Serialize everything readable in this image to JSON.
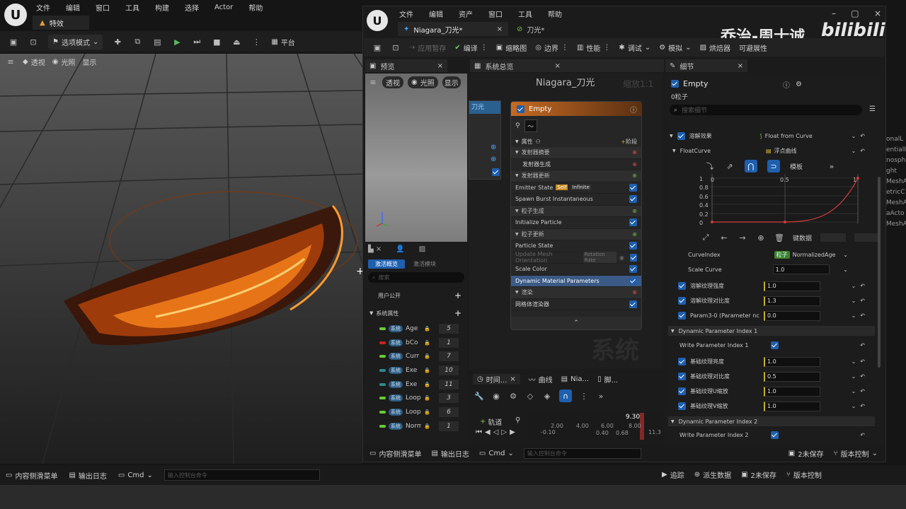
{
  "main": {
    "title": "特效",
    "menu": [
      "文件",
      "编辑",
      "窗口",
      "工具",
      "构建",
      "选择",
      "Actor",
      "帮助"
    ],
    "mode": "选项模式",
    "platform": "平台",
    "viewport_buttons": [
      "透视",
      "光照",
      "显示"
    ]
  },
  "niagara": {
    "menu": [
      "文件",
      "编辑",
      "资产",
      "窗口",
      "工具",
      "帮助"
    ],
    "tabs": [
      "Niagara_刀光*",
      "刀光*"
    ],
    "toolbar": [
      "应用暂存",
      "编译",
      "缩略图",
      "边界",
      "性能",
      "调试",
      "模拟",
      "烘焙器",
      "可避展性"
    ],
    "watermark_name": "乔治-周士诚",
    "watermark_logo": "bilibili",
    "preview": {
      "tab": "预览",
      "buttons": [
        "透视",
        "光照",
        "显示"
      ]
    },
    "params": {
      "tabs": [
        "激活概览",
        "激活模块"
      ],
      "search_placeholder": "搜索",
      "user_section": "用户公开",
      "system_section": "系统属性",
      "tag": "系统",
      "items": [
        {
          "name": "Age",
          "value": "5",
          "color": "#66cc33"
        },
        {
          "name": "bCo",
          "value": "1",
          "color": "#cc2222"
        },
        {
          "name": "Curr",
          "value": "7",
          "color": "#66cc33"
        },
        {
          "name": "Exe",
          "value": "10",
          "color": "#2a8c8c"
        },
        {
          "name": "Exe",
          "value": "11",
          "color": "#2a8c8c"
        },
        {
          "name": "Loop",
          "value": "3",
          "color": "#66cc33"
        },
        {
          "name": "Loop",
          "value": "6",
          "color": "#66cc33"
        },
        {
          "name": "Norm",
          "value": "1",
          "color": "#66cc33"
        }
      ]
    },
    "overview": {
      "tab": "系统总览",
      "title": "Niagara_刀光",
      "zoom": "缩放1:1",
      "node_label": "刀光",
      "watermark": "系统",
      "emitter": {
        "name": "Empty",
        "properties": "属性",
        "stage": "阶段",
        "rows": [
          {
            "label": "发射器摘要",
            "type": "section"
          },
          {
            "label": "发射器生成",
            "type": "sub"
          },
          {
            "label": "发射器更新",
            "type": "section"
          },
          {
            "label": "Emitter State",
            "type": "item",
            "badge1": "Self",
            "badge2": "Infinite"
          },
          {
            "label": "Spawn Burst Instantaneous",
            "type": "item"
          },
          {
            "label": "粒子生成",
            "type": "section"
          },
          {
            "label": "Initialize Particle",
            "type": "item"
          },
          {
            "label": "粒子更新",
            "type": "section"
          },
          {
            "label": "Particle State",
            "type": "item"
          },
          {
            "label": "Update Mesh Orientation",
            "type": "dim",
            "badge1": "Rotation Rate"
          },
          {
            "label": "Scale Color",
            "type": "item"
          },
          {
            "label": "Dynamic Material Parameters",
            "type": "selected"
          },
          {
            "label": "渲染",
            "type": "section"
          },
          {
            "label": "网格体渲染器",
            "type": "item"
          }
        ]
      }
    },
    "timeline": {
      "tabs": [
        "时间...",
        "曲线",
        "Nia...",
        "脚..."
      ],
      "track": "轨道",
      "current": "9.30",
      "ticks": [
        "-0.10",
        "2.00",
        "4.00",
        "6.00",
        "8.00",
        "11.3"
      ],
      "small": [
        "0.40",
        "0.68"
      ]
    },
    "details": {
      "tab": "细节",
      "title": "Empty",
      "subtitle": "0粒子",
      "search_placeholder": "搜索细节",
      "dissolve_label": "溶解效果",
      "dissolve_value": "Float from Curve",
      "floatcurve_label": "FloatCurve",
      "floatcurve_value": "浮点曲线",
      "template": "模板",
      "y_ticks": [
        "1",
        "0.8",
        "0.6",
        "0.4",
        "0.2",
        "0"
      ],
      "x_ticks": [
        "0",
        "0.5",
        "1"
      ],
      "key_data": "键数据",
      "curve_index_label": "CurveIndex",
      "curve_index_tag": "粒子",
      "curve_index_value": "NormalizedAge",
      "scale_curve_label": "Scale Curve",
      "scale_curve_value": "1.0",
      "rows1": [
        {
          "label": "溶解纹理强度",
          "value": "1.0"
        },
        {
          "label": "溶解纹理对比度",
          "value": "1.3"
        },
        {
          "label": "Param3-0 (Parameter nc",
          "value": "0.0"
        }
      ],
      "section1": "Dynamic Parameter Index 1",
      "write1": "Write Parameter Index 1",
      "rows2": [
        {
          "label": "基础纹理亮度",
          "value": "1.0"
        },
        {
          "label": "基础纹理对比度",
          "value": "0.5"
        },
        {
          "label": "基础纹理U缩放",
          "value": "1.0"
        },
        {
          "label": "基础纹理V缩放",
          "value": "1.0"
        }
      ],
      "section2": "Dynamic Parameter Index 2",
      "write2": "Write Parameter Index 2",
      "right_edge": [
        "onalL",
        "entialI",
        "nosph",
        "ght",
        "MeshA",
        "etricC",
        "MeshA",
        "aActo",
        "MeshA"
      ]
    },
    "status": {
      "drawer": "内容侧滑菜单",
      "log": "输出日志",
      "cmd": "Cmd",
      "console": "输入控制台命令",
      "unsaved": "2未保存",
      "version": "版本控制"
    }
  },
  "bottom": {
    "drawer": "内容侧滑菜单",
    "log": "输出日志",
    "cmd": "Cmd",
    "console": "输入控制台命令",
    "trace": "追踪",
    "derived": "派生数据",
    "unsaved": "2未保存",
    "version": "版本控制"
  }
}
